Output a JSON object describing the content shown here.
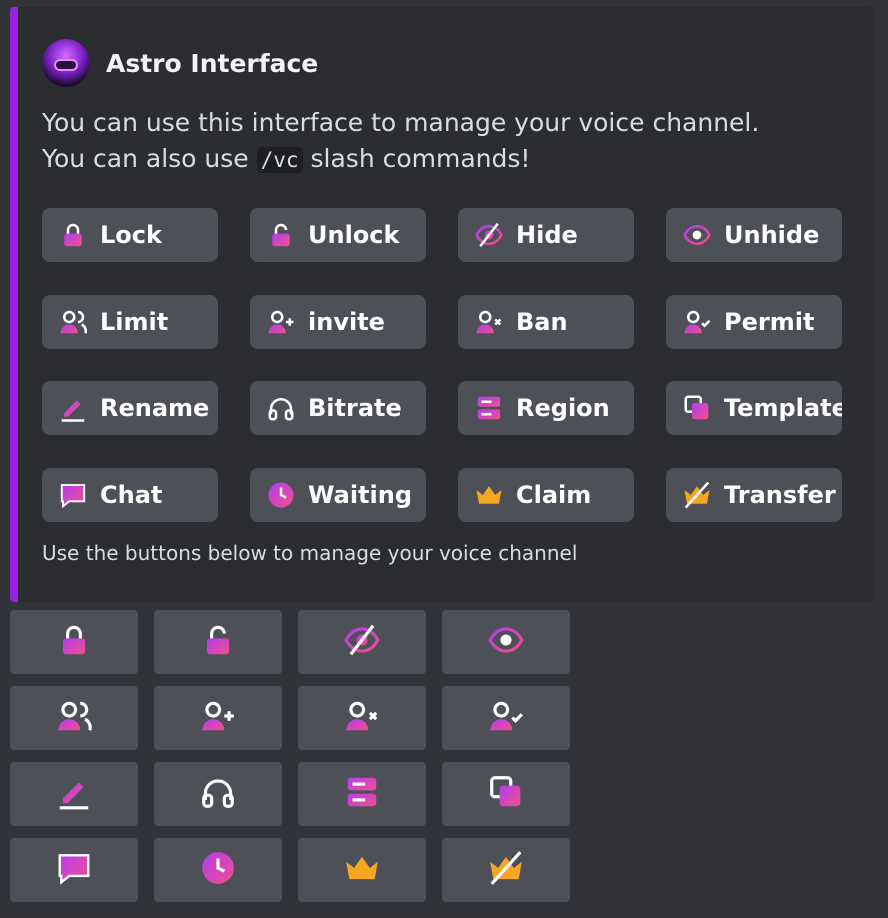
{
  "embed": {
    "author": "Astro Interface",
    "description_line1": "You can use this interface to manage your voice channel.",
    "description_pre": "You can also use ",
    "description_code": "/vc",
    "description_post": " slash commands!",
    "footer": "Use the buttons below to manage your voice channel",
    "accent_color": "#9b1fe0"
  },
  "buttons": [
    {
      "label": "Lock",
      "icon": "lock-icon"
    },
    {
      "label": "Unlock",
      "icon": "unlock-icon"
    },
    {
      "label": "Hide",
      "icon": "hide-icon"
    },
    {
      "label": "Unhide",
      "icon": "eye-icon"
    },
    {
      "label": "Limit",
      "icon": "users-icon"
    },
    {
      "label": "invite",
      "icon": "user-add-icon"
    },
    {
      "label": "Ban",
      "icon": "user-x-icon"
    },
    {
      "label": "Permit",
      "icon": "user-check-icon"
    },
    {
      "label": "Rename",
      "icon": "pencil-icon"
    },
    {
      "label": "Bitrate",
      "icon": "headphones-icon"
    },
    {
      "label": "Region",
      "icon": "server-icon"
    },
    {
      "label": "Template",
      "icon": "template-icon"
    },
    {
      "label": "Chat",
      "icon": "chat-icon"
    },
    {
      "label": "Waiting",
      "icon": "clock-icon"
    },
    {
      "label": "Claim",
      "icon": "crown-icon"
    },
    {
      "label": "Transfer",
      "icon": "crown-slash-icon"
    }
  ],
  "icon_buttons": [
    "lock-icon",
    "unlock-icon",
    "hide-icon",
    "eye-icon",
    "users-icon",
    "user-add-icon",
    "user-x-icon",
    "user-check-icon",
    "pencil-icon",
    "headphones-icon",
    "server-icon",
    "template-icon",
    "chat-icon",
    "clock-icon",
    "crown-icon",
    "crown-slash-icon"
  ],
  "colors": {
    "icon_gradient_start": "#b43cf0",
    "icon_gradient_end": "#f0508c",
    "crown": "#f5a623"
  }
}
